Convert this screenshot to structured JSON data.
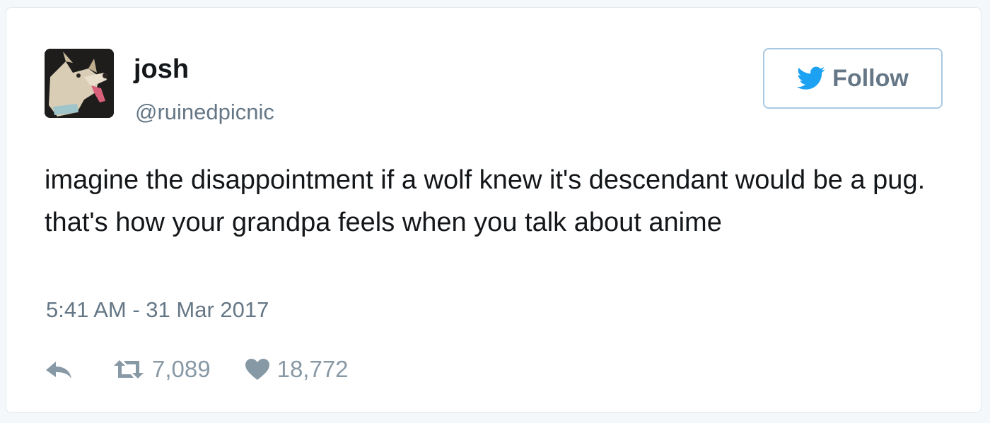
{
  "tweet": {
    "display_name": "josh",
    "handle": "@ruinedpicnic",
    "follow_label": "Follow",
    "text": "imagine the disappointment if a wolf knew it's descendant would be a pug. that's how your grandpa feels when you talk about anime",
    "timestamp": "5:41 AM - 31 Mar 2017",
    "retweet_count": "7,089",
    "like_count": "18,772"
  },
  "icons": {
    "avatar": "dog-photo-avatar",
    "follow": "twitter-bird-icon",
    "reply": "reply-icon",
    "retweet": "retweet-icon",
    "like": "heart-icon"
  },
  "colors": {
    "twitter_blue": "#1da1f2",
    "text": "#14171a",
    "secondary_text": "#657786",
    "action_gray": "#8899a6",
    "card_border": "#e1e8ed"
  }
}
